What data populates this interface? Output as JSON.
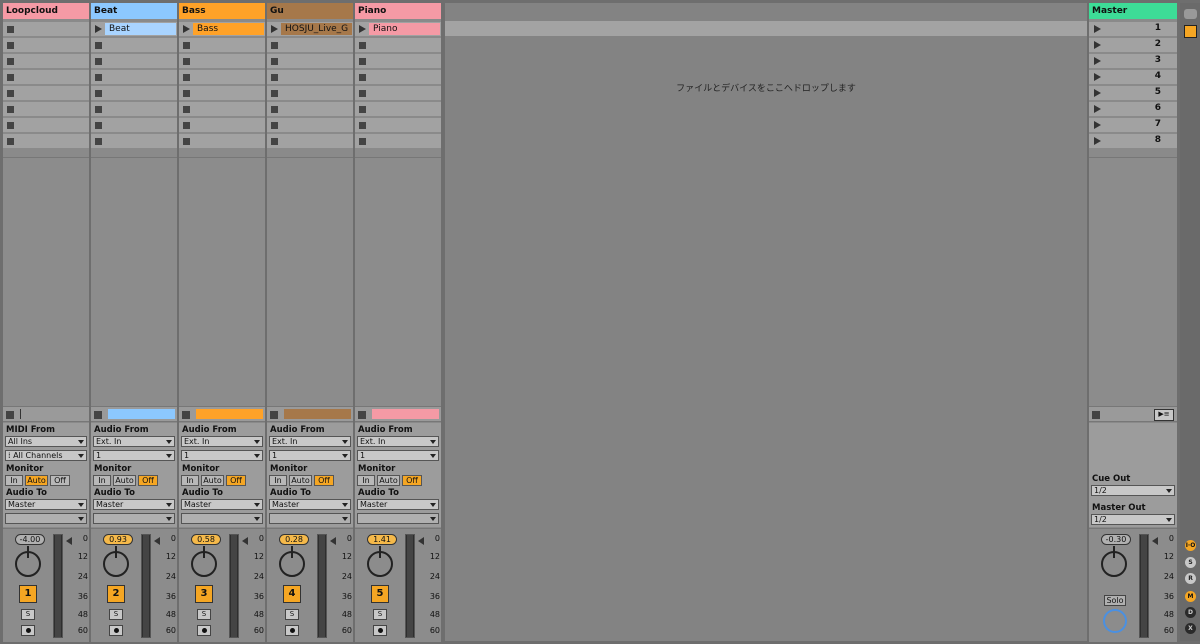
{
  "tracks": [
    {
      "name": "Loopcloud",
      "color": "#f59aa5",
      "clip": "",
      "clip_color": "",
      "input_label": "MIDI From",
      "input_source": "All Ins",
      "input_channel": "All Channels",
      "monitor_label": "Monitor",
      "monitor": [
        "In",
        "Auto",
        "Off"
      ],
      "monitor_active": "Auto",
      "output_label": "Audio To",
      "output": "Master",
      "volume": "-4.00",
      "number": "1",
      "solo": "S",
      "stopbar_color": ""
    },
    {
      "name": "Beat",
      "color": "#8cc8ff",
      "clip": "Beat",
      "clip_color": "#a9d4ff",
      "input_label": "Audio From",
      "input_source": "Ext. In",
      "input_channel": "1",
      "monitor_label": "Monitor",
      "monitor": [
        "In",
        "Auto",
        "Off"
      ],
      "monitor_active": "Off",
      "output_label": "Audio To",
      "output": "Master",
      "volume": "0.93",
      "number": "2",
      "solo": "S",
      "stopbar_color": "#8cc8ff"
    },
    {
      "name": "Bass",
      "color": "#ffa228",
      "clip": "Bass",
      "clip_color": "#ffa228",
      "input_label": "Audio From",
      "input_source": "Ext. In",
      "input_channel": "1",
      "monitor_label": "Monitor",
      "monitor": [
        "In",
        "Auto",
        "Off"
      ],
      "monitor_active": "Off",
      "output_label": "Audio To",
      "output": "Master",
      "volume": "0.58",
      "number": "3",
      "solo": "S",
      "stopbar_color": "#ffa228"
    },
    {
      "name": "Gu",
      "color": "#a6784a",
      "clip": "HOSJU_Live_G",
      "clip_color": "#a6784a",
      "input_label": "Audio From",
      "input_source": "Ext. In",
      "input_channel": "1",
      "monitor_label": "Monitor",
      "monitor": [
        "In",
        "Auto",
        "Off"
      ],
      "monitor_active": "Off",
      "output_label": "Audio To",
      "output": "Master",
      "volume": "0.28",
      "number": "4",
      "solo": "S",
      "stopbar_color": "#a6784a"
    },
    {
      "name": "Piano",
      "color": "#f59aa5",
      "clip": "Piano",
      "clip_color": "#f59aa5",
      "input_label": "Audio From",
      "input_source": "Ext. In",
      "input_channel": "1",
      "monitor_label": "Monitor",
      "monitor": [
        "In",
        "Auto",
        "Off"
      ],
      "monitor_active": "Off",
      "output_label": "Audio To",
      "output": "Master",
      "volume": "1.41",
      "number": "5",
      "solo": "S",
      "stopbar_color": "#f59aa5"
    }
  ],
  "drop_text": "ファイルとデバイスをここへドロップします",
  "master": {
    "name": "Master",
    "color": "#3ddc97",
    "scenes": [
      "1",
      "2",
      "3",
      "4",
      "5",
      "6",
      "7",
      "8"
    ],
    "cue_out_label": "Cue Out",
    "cue_out": "1/2",
    "master_out_label": "Master Out",
    "master_out": "1/2",
    "volume": "-0.30",
    "solo_label": "Solo"
  },
  "meter_scale": [
    "0",
    "12",
    "24",
    "36",
    "48",
    "60"
  ],
  "side_buttons": [
    "I·O",
    "S",
    "R",
    "M",
    "D",
    "X"
  ]
}
